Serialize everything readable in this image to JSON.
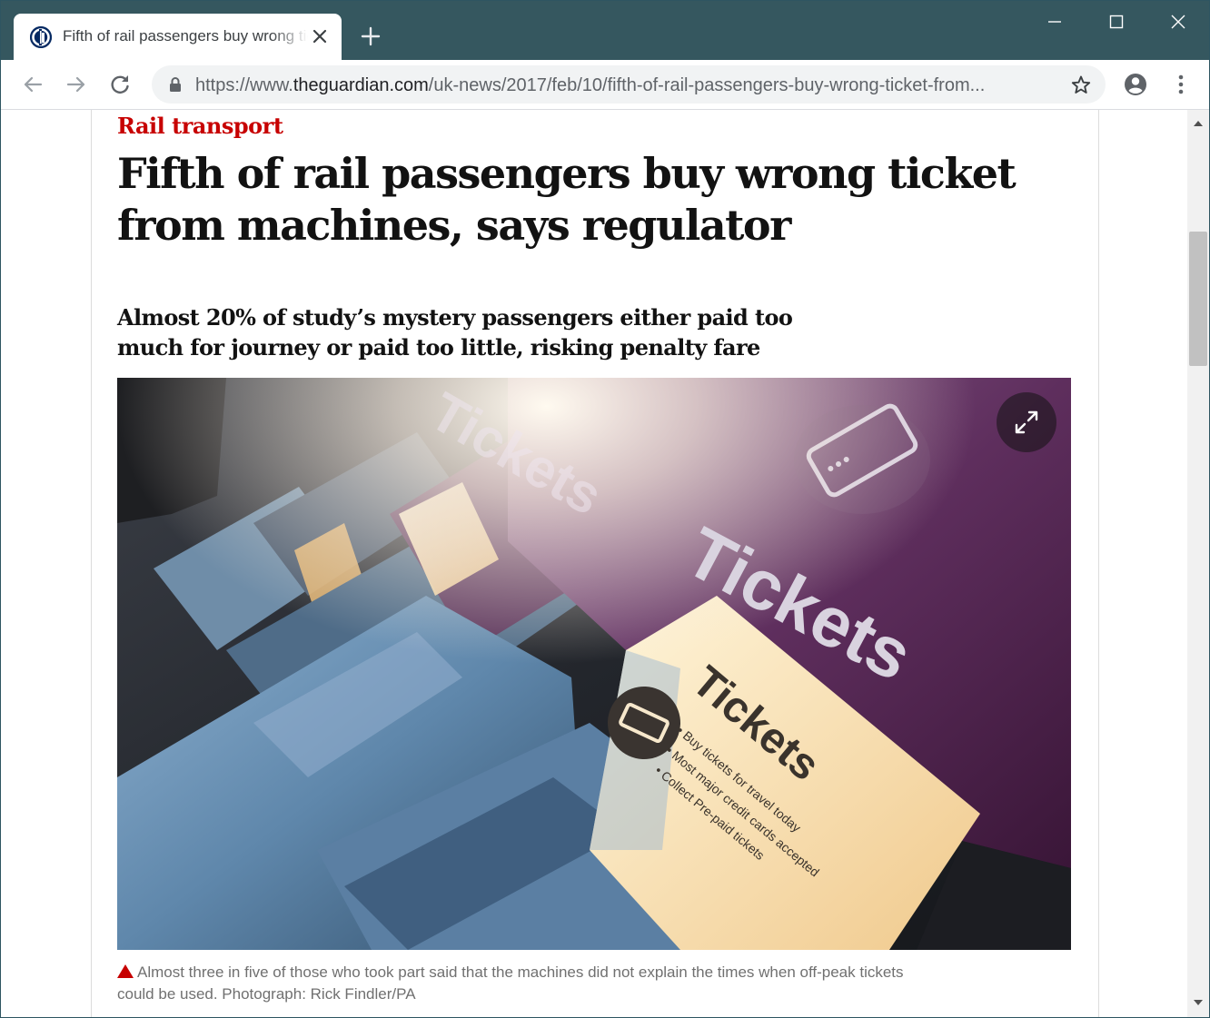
{
  "browser": {
    "tab_title": "Fifth of rail passengers buy wrong ticket from machines, says regulator",
    "url_prefix": "https://www.",
    "url_host": "theguardian.com",
    "url_path": "/uk-news/2017/feb/10/fifth-of-rail-passengers-buy-wrong-ticket-from...",
    "icons": {
      "favicon": "guardian-favicon",
      "tab_close": "close-icon",
      "new_tab": "plus-icon",
      "minimize": "minimize-icon",
      "maximize": "maximize-icon",
      "window_close": "close-icon",
      "back": "back-arrow-icon",
      "forward": "forward-arrow-icon",
      "reload": "reload-icon",
      "lock": "lock-icon",
      "bookmark": "star-icon",
      "account": "account-icon",
      "menu": "more-vert-icon"
    },
    "colors": {
      "titlebar": "#35575f",
      "tab": "#ffffff",
      "omnibox": "#f1f3f4"
    }
  },
  "article": {
    "kicker": "Rail transport",
    "headline": "Fifth of rail passengers buy wrong ticket from machines, says regulator",
    "standfirst": "Almost 20% of study’s mystery passengers either paid too much for journey or paid too little, risking penalty fare",
    "photo": {
      "machine_sign_large": "Tickets",
      "machine_sign_small": "Tickets",
      "panel_lines": [
        "• Buy tickets for travel today",
        "• Most major credit cards accepted",
        "• Collect Pre-paid tickets"
      ],
      "expand_icon": "expand-arrows-icon"
    },
    "caption": "Almost three in five of those who took part said that the machines did not explain the times when off-peak tickets could be used. Photograph: Rick Findler/PA",
    "colors": {
      "kicker": "#c70000",
      "headline": "#121212",
      "caption": "#707070"
    }
  },
  "scrollbar": {
    "up_icon": "scroll-up-arrow-icon",
    "down_icon": "scroll-down-arrow-icon"
  }
}
